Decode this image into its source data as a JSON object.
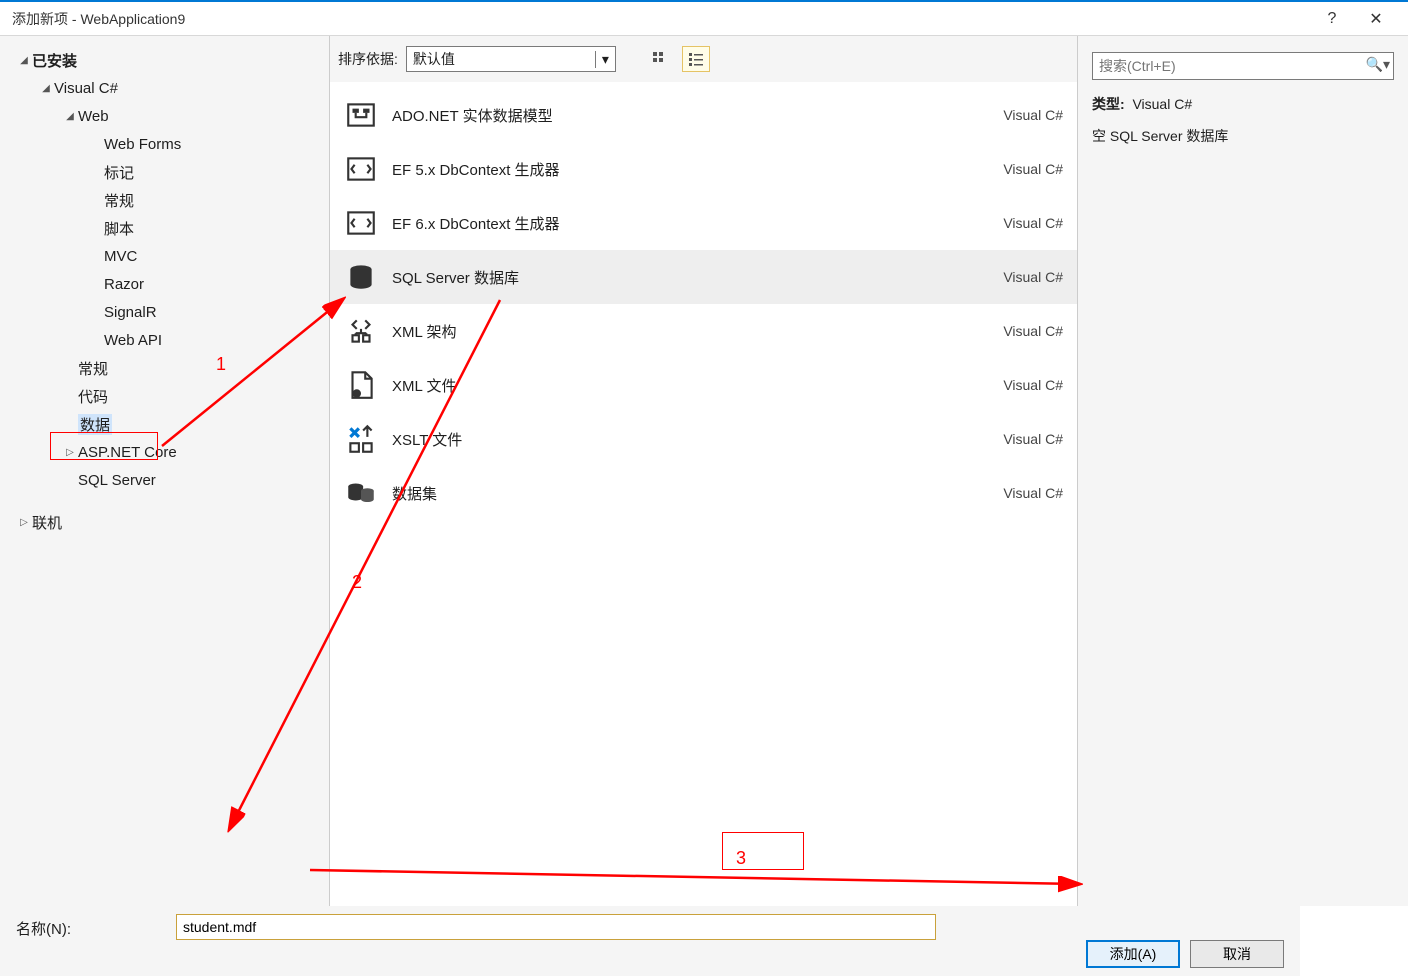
{
  "window": {
    "title": "添加新项 - WebApplication9"
  },
  "tree": {
    "installed": "已安装",
    "csharp": "Visual C#",
    "web": "Web",
    "webforms": "Web Forms",
    "biaoji": "标记",
    "changgui_sub": "常规",
    "jiaoben": "脚本",
    "mvc": "MVC",
    "razor": "Razor",
    "signalr": "SignalR",
    "webapi": "Web API",
    "changgui": "常规",
    "daima": "代码",
    "shuju": "数据",
    "aspnetcore": "ASP.NET Core",
    "sqlserver": "SQL Server",
    "online": "联机"
  },
  "toolbar": {
    "sortby_label": "排序依据:",
    "sort_value": "默认值"
  },
  "icons": {
    "grid": "grid-icon",
    "list": "list-icon"
  },
  "templates": [
    {
      "name": "ADO.NET 实体数据模型",
      "lang": "Visual C#"
    },
    {
      "name": "EF 5.x DbContext 生成器",
      "lang": "Visual C#"
    },
    {
      "name": "EF 6.x DbContext 生成器",
      "lang": "Visual C#"
    },
    {
      "name": "SQL Server 数据库",
      "lang": "Visual C#"
    },
    {
      "name": "XML 架构",
      "lang": "Visual C#"
    },
    {
      "name": "XML 文件",
      "lang": "Visual C#"
    },
    {
      "name": "XSLT 文件",
      "lang": "Visual C#"
    },
    {
      "name": "数据集",
      "lang": "Visual C#"
    }
  ],
  "search": {
    "placeholder": "搜索(Ctrl+E)"
  },
  "info": {
    "type_label": "类型:",
    "type_value": "Visual C#",
    "description": "空 SQL Server 数据库"
  },
  "bottom": {
    "name_label": "名称(N):",
    "name_value": "student.mdf",
    "add_label": "添加(A)",
    "cancel_label": "取消"
  },
  "annotations": {
    "n1": "1",
    "n2": "2",
    "n3": "3"
  }
}
